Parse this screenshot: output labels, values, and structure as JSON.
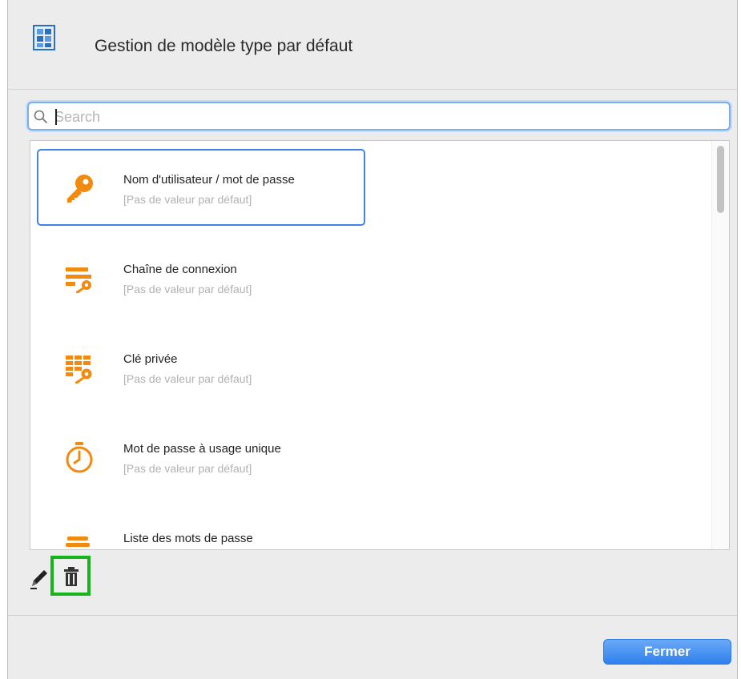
{
  "header": {
    "title": "Gestion de modèle type par défaut",
    "icon": "template-grid-icon"
  },
  "search": {
    "placeholder": "Search",
    "value": ""
  },
  "list": {
    "items": [
      {
        "title": "Nom d'utilisateur / mot de passe",
        "subtitle": "[Pas de valeur par défaut]",
        "icon": "key-icon",
        "selected": true
      },
      {
        "title": "Chaîne de connexion",
        "subtitle": "[Pas de valeur par défaut]",
        "icon": "connection-string-icon"
      },
      {
        "title": "Clé privée",
        "subtitle": "[Pas de valeur par défaut]",
        "icon": "private-key-icon"
      },
      {
        "title": "Mot de passe à usage unique",
        "subtitle": "[Pas de valeur par défaut]",
        "icon": "timer-icon"
      },
      {
        "title": "Liste des mots de passe",
        "subtitle": "",
        "icon": "password-list-icon"
      }
    ]
  },
  "toolbar": {
    "edit_icon": "pencil-icon",
    "delete_icon": "trash-icon"
  },
  "footer": {
    "close_label": "Fermer"
  },
  "colors": {
    "accent": "#f28a10",
    "selection": "#3f84e8",
    "highlight": "#17b51b"
  }
}
